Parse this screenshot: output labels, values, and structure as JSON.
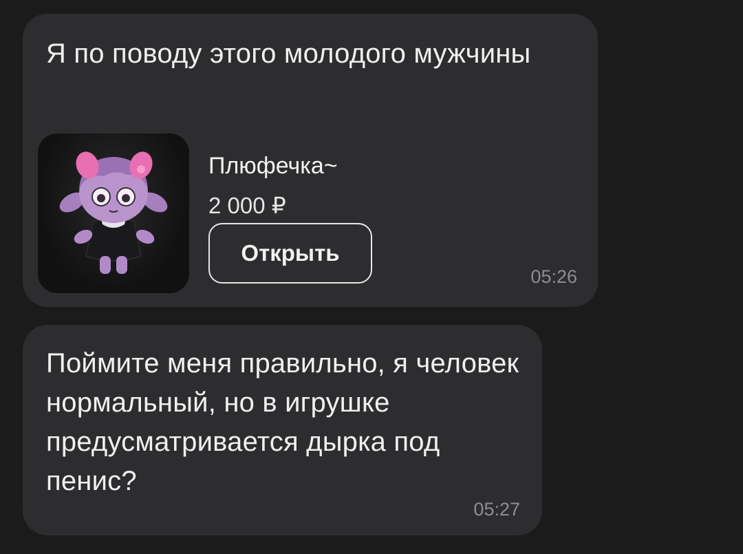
{
  "messages": [
    {
      "text": "Я по поводу этого молодого мужчины",
      "time": "05:26",
      "product": {
        "name": "Плюфечка~",
        "price": "2 000 ₽",
        "open_label": "Открыть",
        "image_icon": "plush-toy-photo"
      }
    },
    {
      "text": "Поймите меня правильно, я человек нормальный, но в игрушке предусматривается дырка под пенис?",
      "time": "05:27"
    }
  ],
  "colors": {
    "background": "#1b1b1c",
    "bubble": "#2d2d2f",
    "text": "#f0f0f0",
    "time": "#8e8e92",
    "button_border": "#e8e8e8"
  }
}
